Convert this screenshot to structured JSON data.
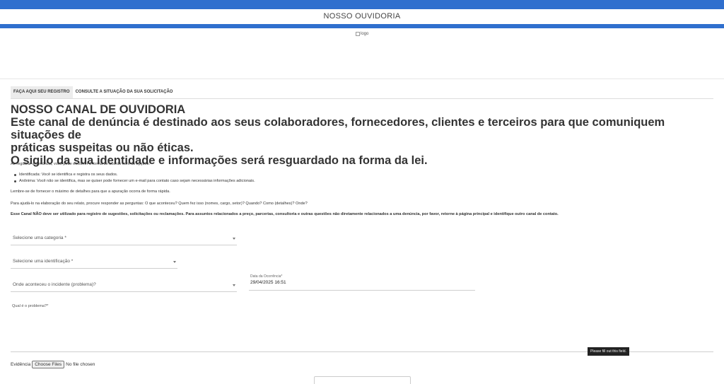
{
  "header": {
    "title": "NOSSO OUVIDORIA"
  },
  "logo": {
    "alt": "logo"
  },
  "tabs": [
    {
      "label": "FAÇA AQUI SEU REGISTRO",
      "active": true
    },
    {
      "label": "CONSULTE A SITUAÇÃO DA SUA SOLICITAÇÃO",
      "active": false
    }
  ],
  "intro": {
    "title": "NOSSO CANAL DE OUVIDORIA",
    "line1": "Este canal de denúncia é destinado aos seus colaboradores, fornecedores, clientes e terceiros para que comuniquem situações de",
    "line2": "práticas suspeitas ou não éticas.",
    "line3": "O sigilo da sua identidade e informações será resguardado na forma da lei.",
    "options_intro": "Ao registrar a denúncia, você pode escolher a forma de acordo com as opções:",
    "options": [
      "Identificada: Você se identifica e registra os seus dados.",
      "Anônima: Você não se identifica, mas se quiser pode fornecer um e-mail para contato caso sejam necessárias informações adicionais."
    ],
    "reminder": "Lembre-se de fornecer o máximo de detalhes para que a apuração ocorra de forma rápida.",
    "questions": "Para ajudá-lo na elaboração do seu relato, procure responder as perguntas: O que aconteceu? Quem fez isso (nomes, cargo, setor)? Quando? Como (detalhes)? Onde?",
    "warning": "Esse Canal NÃO deve ser utilizado para registro de sugestões, solicitações ou reclamações. Para assuntos relacionados a preço, parcerias, consultoria e outras questões não diretamente relacionados a uma denúncia, por favor, retorne à página principal e identifique outro canal de contato."
  },
  "form": {
    "category_placeholder": "Selecione uma categoria *",
    "identification_placeholder": "Selecione uma identificação *",
    "location_placeholder": "Onde aconteceu o incidente (problema)?",
    "date_label": "Data da Ocorrência*",
    "date_value": "29/04/2025 16:51",
    "problem_label": "Qual é o problema?*",
    "tooltip": "Please fill out this field.",
    "evidence_label": "Evidência",
    "file_button": "Choose Files",
    "file_status": "No file chosen"
  }
}
